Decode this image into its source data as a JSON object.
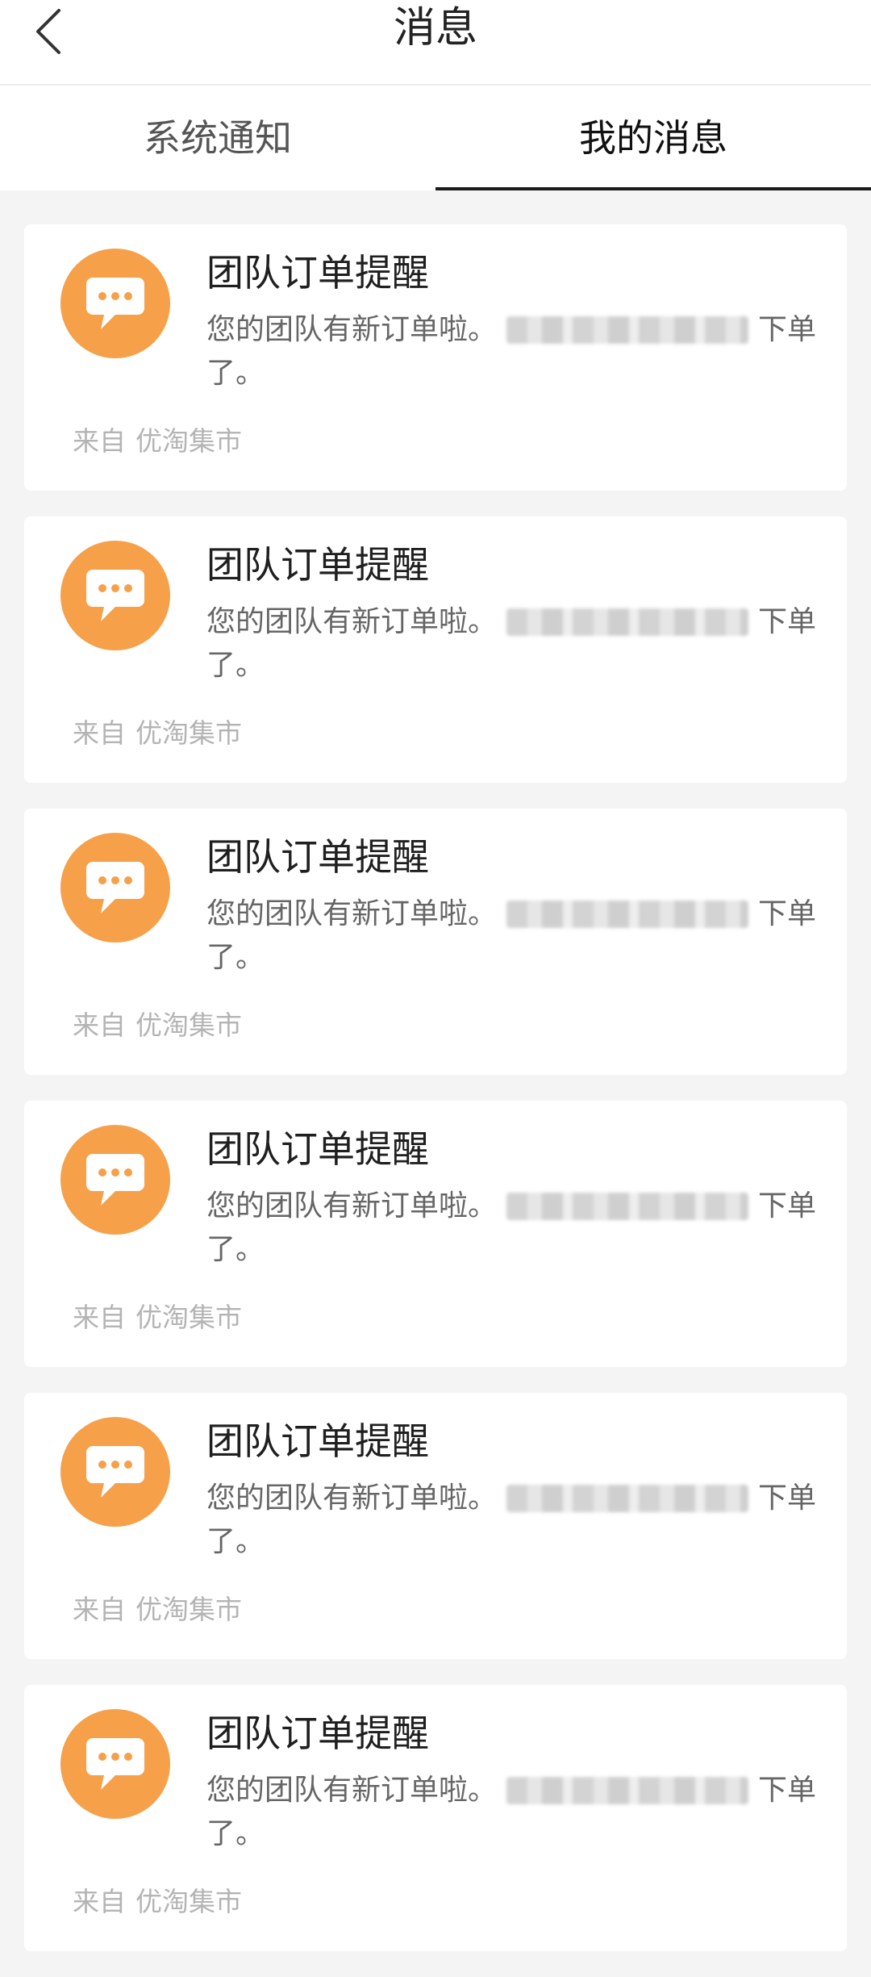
{
  "header": {
    "title": "消息"
  },
  "tabs": [
    {
      "label": "系统通知",
      "active": false
    },
    {
      "label": "我的消息",
      "active": true
    }
  ],
  "colors": {
    "accent": "#f6a04a",
    "background": "#f4f4f4"
  },
  "messages": [
    {
      "icon": "chat-bubble-icon",
      "title": "团队订单提醒",
      "body_prefix": "您的团队有新订单啦。",
      "body_suffix": "下单",
      "body_line2": "了。",
      "source_label": "来自",
      "source": "优淘集市"
    },
    {
      "icon": "chat-bubble-icon",
      "title": "团队订单提醒",
      "body_prefix": "您的团队有新订单啦。",
      "body_suffix": "下单",
      "body_line2": "了。",
      "source_label": "来自",
      "source": "优淘集市"
    },
    {
      "icon": "chat-bubble-icon",
      "title": "团队订单提醒",
      "body_prefix": "您的团队有新订单啦。",
      "body_suffix": "下单",
      "body_line2": "了。",
      "source_label": "来自",
      "source": "优淘集市"
    },
    {
      "icon": "chat-bubble-icon",
      "title": "团队订单提醒",
      "body_prefix": "您的团队有新订单啦。",
      "body_suffix": "下单",
      "body_line2": "了。",
      "source_label": "来自",
      "source": "优淘集市"
    },
    {
      "icon": "chat-bubble-icon",
      "title": "团队订单提醒",
      "body_prefix": "您的团队有新订单啦。",
      "body_suffix": "下单",
      "body_line2": "了。",
      "source_label": "来自",
      "source": "优淘集市"
    },
    {
      "icon": "chat-bubble-icon",
      "title": "团队订单提醒",
      "body_prefix": "您的团队有新订单啦。",
      "body_suffix": "下单",
      "body_line2": "了。",
      "source_label": "来自",
      "source": "优淘集市"
    }
  ]
}
